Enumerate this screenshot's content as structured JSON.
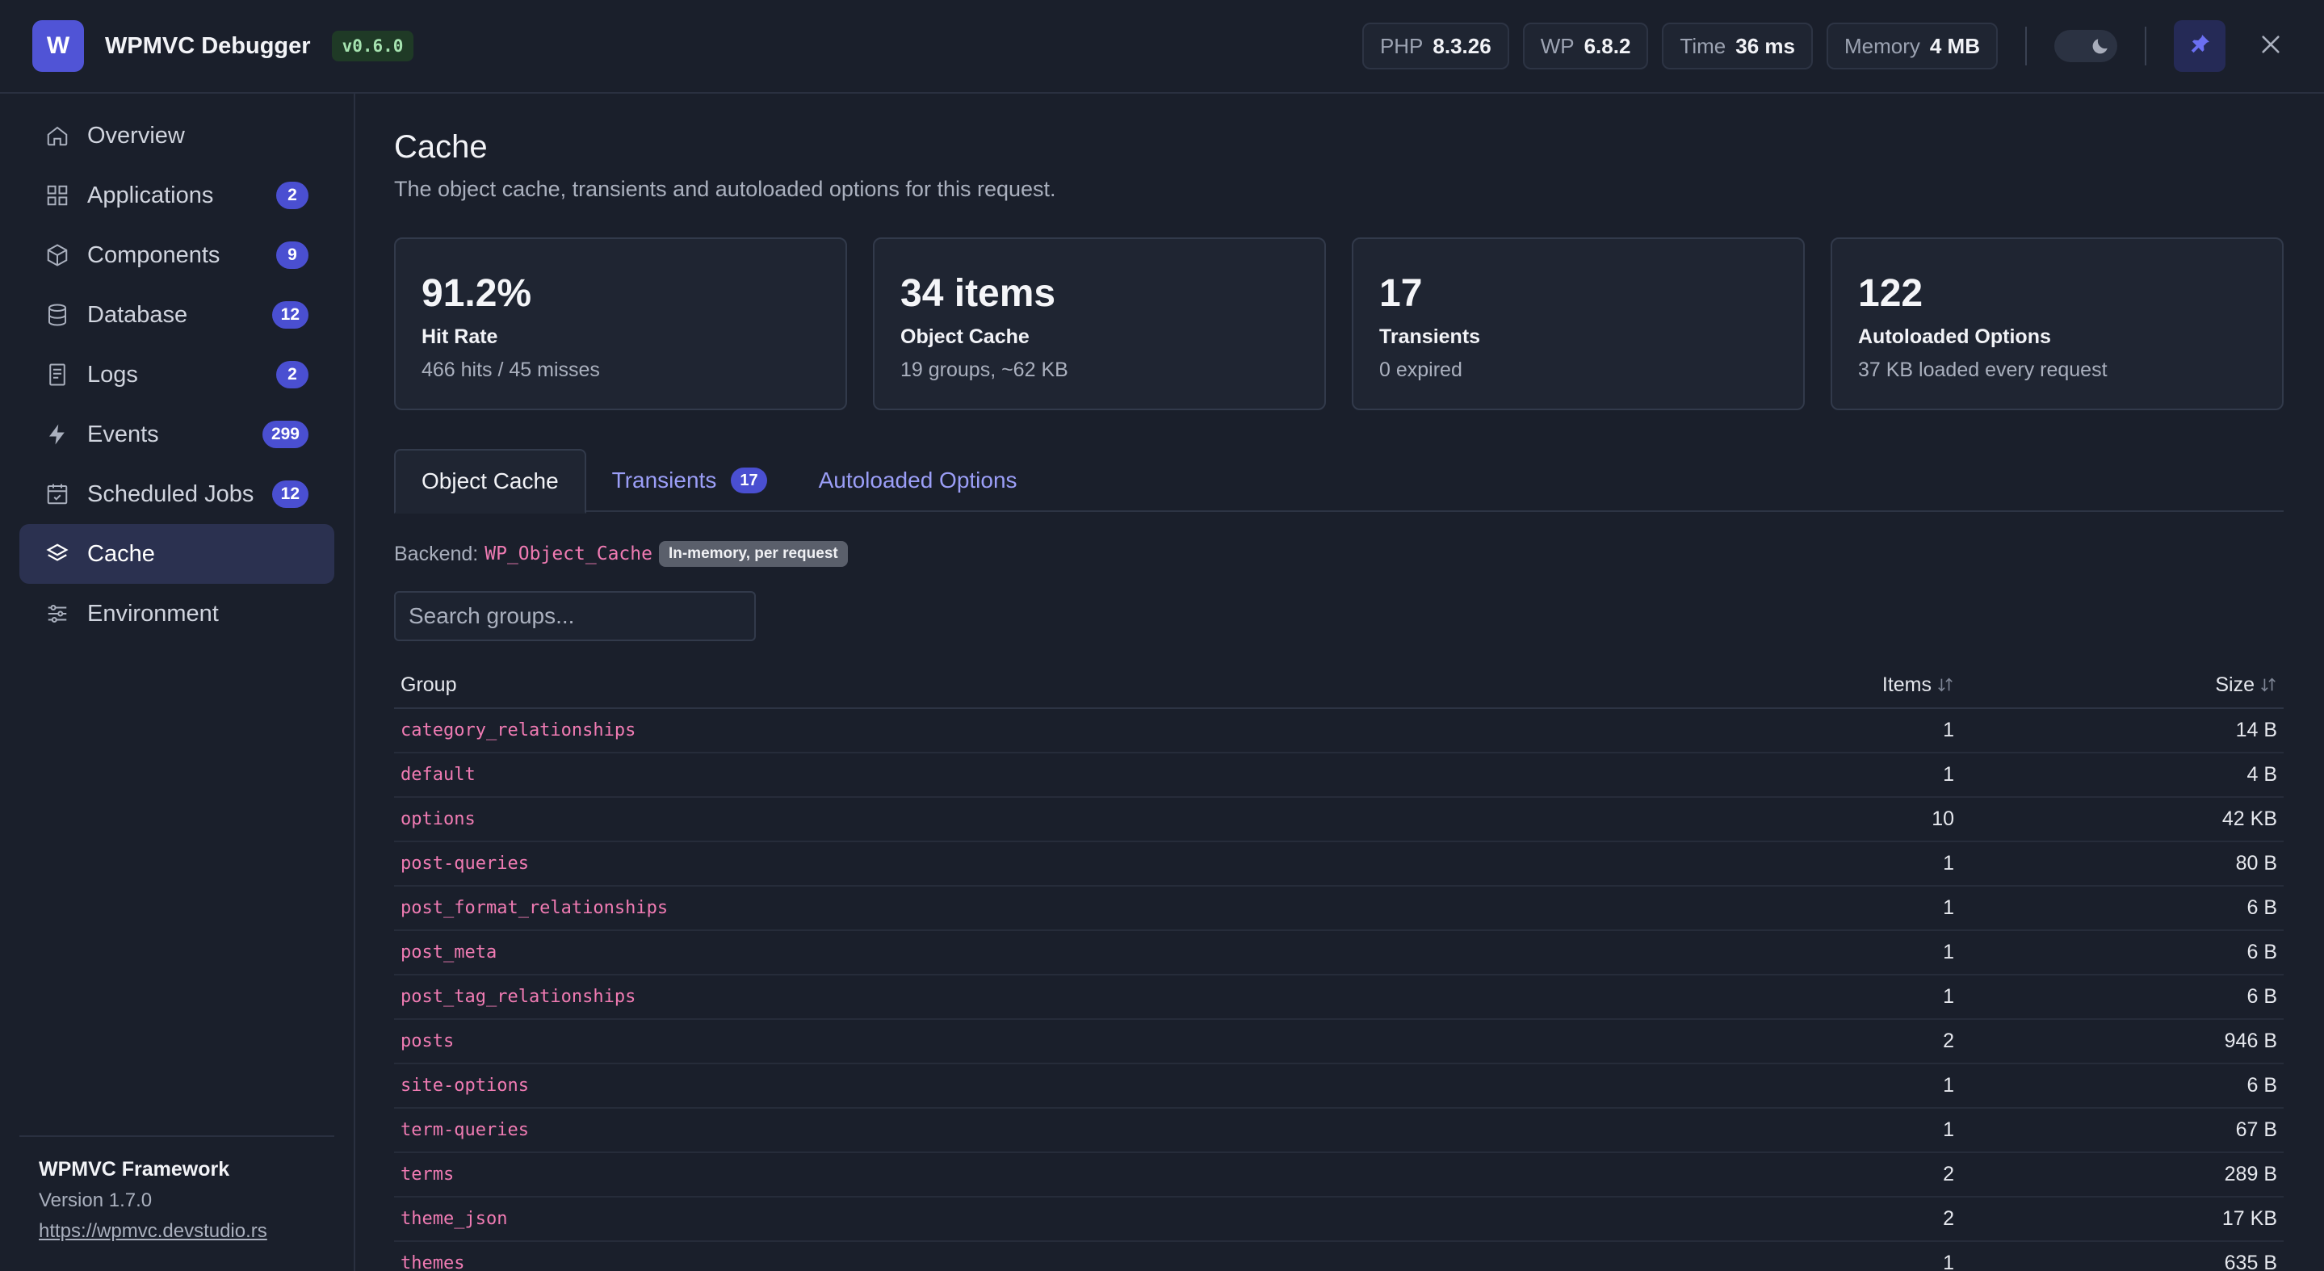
{
  "header": {
    "logo_letter": "W",
    "title": "WPMVC Debugger",
    "version": "v0.6.0",
    "stats": [
      {
        "key": "PHP",
        "value": "8.3.26"
      },
      {
        "key": "WP",
        "value": "6.8.2"
      },
      {
        "key": "Time",
        "value": "36 ms"
      },
      {
        "key": "Memory",
        "value": "4 MB"
      }
    ],
    "icons": {
      "theme_toggle": "moon-icon",
      "pin": "pin-icon",
      "close": "close-icon"
    }
  },
  "sidebar": {
    "items": [
      {
        "label": "Overview",
        "icon": "home-icon",
        "count": ""
      },
      {
        "label": "Applications",
        "icon": "grid-icon",
        "count": "2"
      },
      {
        "label": "Components",
        "icon": "cube-icon",
        "count": "9"
      },
      {
        "label": "Database",
        "icon": "database-icon",
        "count": "12"
      },
      {
        "label": "Logs",
        "icon": "document-icon",
        "count": "2"
      },
      {
        "label": "Events",
        "icon": "lightning-icon",
        "count": "299"
      },
      {
        "label": "Scheduled Jobs",
        "icon": "calendar-icon",
        "count": "12"
      },
      {
        "label": "Cache",
        "icon": "layers-icon",
        "count": ""
      },
      {
        "label": "Environment",
        "icon": "sliders-icon",
        "count": ""
      }
    ],
    "active": "Cache",
    "footer": {
      "name": "WPMVC Framework",
      "version": "Version 1.7.0",
      "link": "https://wpmvc.devstudio.rs"
    }
  },
  "main": {
    "title": "Cache",
    "subtitle": "The object cache, transients and autoloaded options for this request.",
    "cards": [
      {
        "big": "91.2%",
        "name": "Hit Rate",
        "desc": "466 hits / 45 misses"
      },
      {
        "big": "34 items",
        "name": "Object Cache",
        "desc": "19 groups, ~62 KB"
      },
      {
        "big": "17",
        "name": "Transients",
        "desc": "0 expired"
      },
      {
        "big": "122",
        "name": "Autoloaded Options",
        "desc": "37 KB loaded every request"
      }
    ],
    "tabs": [
      {
        "label": "Object Cache",
        "count": ""
      },
      {
        "label": "Transients",
        "count": "17"
      },
      {
        "label": "Autoloaded Options",
        "count": ""
      }
    ],
    "backend": {
      "label": "Backend:",
      "name": "WP_Object_Cache",
      "tag": "In-memory, per request"
    },
    "search": {
      "placeholder": "Search groups..."
    },
    "table": {
      "headers": {
        "group": "Group",
        "items": "Items",
        "size": "Size"
      },
      "rows": [
        {
          "group": "category_relationships",
          "items": "1",
          "size": "14 B"
        },
        {
          "group": "default",
          "items": "1",
          "size": "4 B"
        },
        {
          "group": "options",
          "items": "10",
          "size": "42 KB"
        },
        {
          "group": "post-queries",
          "items": "1",
          "size": "80 B"
        },
        {
          "group": "post_format_relationships",
          "items": "1",
          "size": "6 B"
        },
        {
          "group": "post_meta",
          "items": "1",
          "size": "6 B"
        },
        {
          "group": "post_tag_relationships",
          "items": "1",
          "size": "6 B"
        },
        {
          "group": "posts",
          "items": "2",
          "size": "946 B"
        },
        {
          "group": "site-options",
          "items": "1",
          "size": "6 B"
        },
        {
          "group": "term-queries",
          "items": "1",
          "size": "67 B"
        },
        {
          "group": "terms",
          "items": "2",
          "size": "289 B"
        },
        {
          "group": "theme_json",
          "items": "2",
          "size": "17 KB"
        },
        {
          "group": "themes",
          "items": "1",
          "size": "635 B"
        }
      ]
    }
  }
}
